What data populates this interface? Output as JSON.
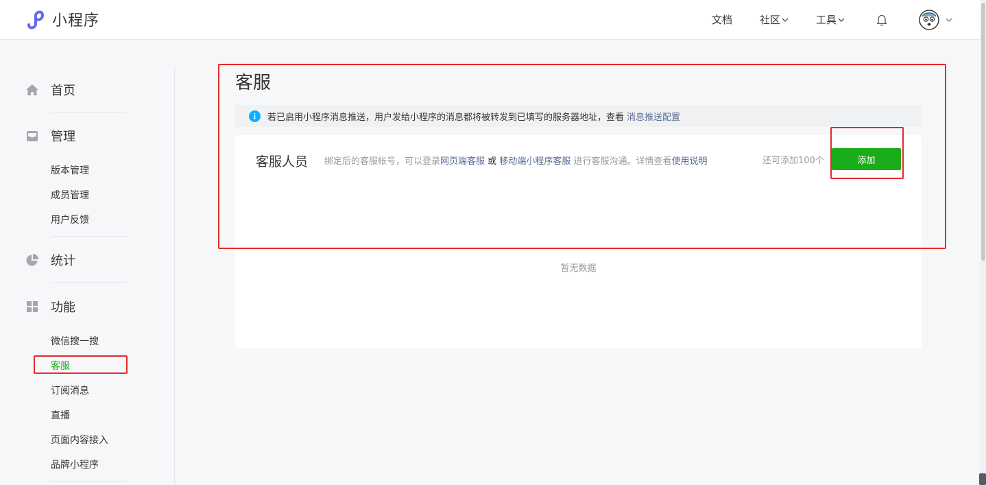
{
  "app": {
    "name": "小程序"
  },
  "topnav": {
    "docs": "文档",
    "community": "社区",
    "tools": "工具"
  },
  "sidebar": {
    "home": "首页",
    "manage": {
      "label": "管理",
      "items": [
        "版本管理",
        "成员管理",
        "用户反馈"
      ]
    },
    "stats": "统计",
    "features": {
      "label": "功能",
      "items": [
        "微信搜一搜",
        "客服",
        "订阅消息",
        "直播",
        "页面内容接入",
        "品牌小程序"
      ]
    }
  },
  "main": {
    "title": "客服",
    "info": {
      "text": "若已启用小程序消息推送，用户发给小程序的消息都将被转发到已填写的服务器地址，查看",
      "link": "消息推送配置"
    },
    "panel": {
      "label": "客服人员",
      "desc_prefix": "绑定后的客服帐号，可以登录",
      "web_link": "网页端客服",
      "or": "或",
      "mobile_link": "移动端小程序客服",
      "desc_middle": "进行客服沟通。详情查看",
      "help_link": "使用说明",
      "remaining": "还可添加100个",
      "add_button": "添加",
      "empty": "暂无数据"
    }
  },
  "colors": {
    "accent_green": "#1aad19",
    "link_blue": "#576b95",
    "highlight_red": "#e42a2a",
    "info_blue": "#10aeff"
  },
  "icons": {
    "logo": "miniprogram-logo-icon",
    "home": "home-icon",
    "manage": "inbox-icon",
    "stats": "pie-chart-icon",
    "features": "grid-icon",
    "info": "info-icon",
    "bell": "bell-icon"
  }
}
